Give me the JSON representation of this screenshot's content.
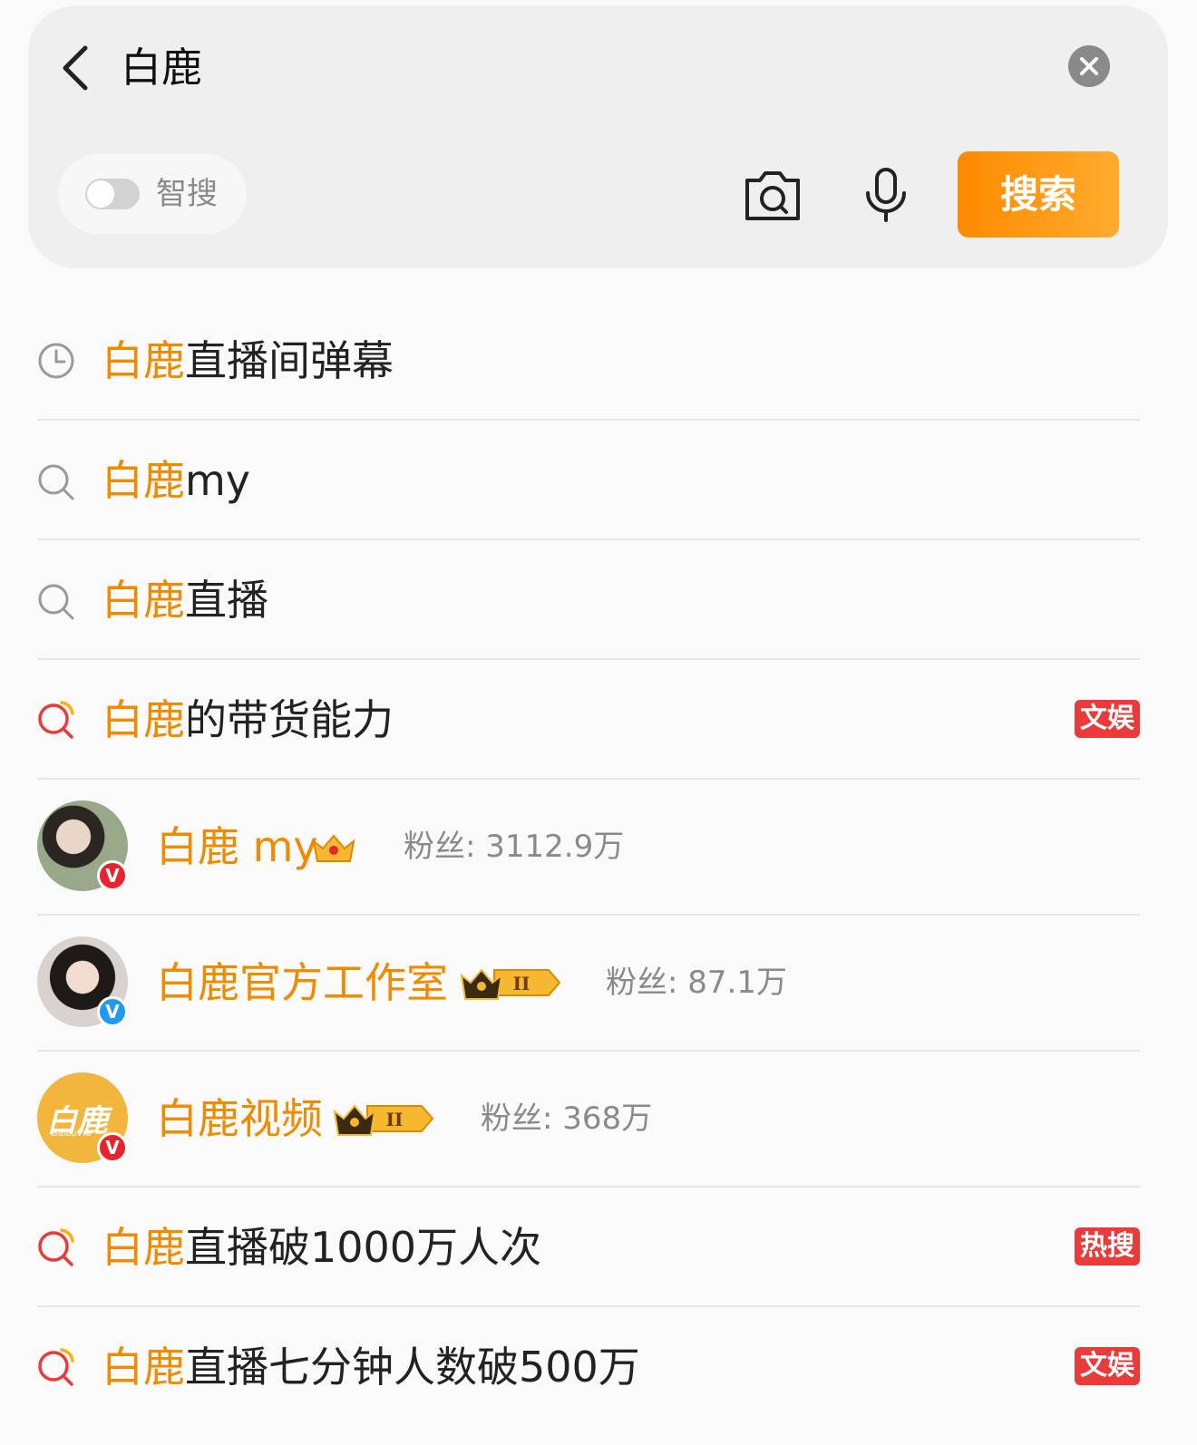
{
  "search": {
    "query": "白鹿",
    "smart_search_label": "智搜",
    "search_button_label": "搜索"
  },
  "colors": {
    "accent": "#f08a00",
    "tag_red": "#ea3a3a",
    "verified_red": "#e8232e",
    "verified_blue": "#1d9bf0"
  },
  "suggestions": [
    {
      "type": "history",
      "icon": "clock-icon",
      "highlight": "白鹿",
      "rest": "直播间弹幕"
    },
    {
      "type": "suggest",
      "icon": "search-icon",
      "highlight": "白鹿",
      "rest": "my"
    },
    {
      "type": "suggest",
      "icon": "search-icon",
      "highlight": "白鹿",
      "rest": "直播"
    },
    {
      "type": "hot",
      "icon": "hot-search-icon",
      "highlight": "白鹿",
      "rest": "的带货能力",
      "tag": "文娱"
    }
  ],
  "users": [
    {
      "name": "白鹿 my",
      "fans": "粉丝: 3112.9万",
      "verified": "red-v-badge",
      "badge": "crown-badge"
    },
    {
      "name": "白鹿官方工作室",
      "fans": "粉丝: 87.1万",
      "verified": "blue-v-badge",
      "badge": "member-level-ii-badge"
    },
    {
      "name": "白鹿视频",
      "fans": "粉丝: 368万",
      "verified": "red-v-badge",
      "badge": "member-level-ii-badge",
      "avatar_text": "白鹿",
      "avatar_subtext": "BaiLuVid"
    }
  ],
  "trending": [
    {
      "icon": "hot-search-icon",
      "highlight": "白鹿",
      "rest": "直播破1000万人次",
      "tag": "热搜"
    },
    {
      "icon": "hot-search-icon",
      "highlight": "白鹿",
      "rest": "直播七分钟人数破500万",
      "tag": "文娱"
    }
  ]
}
